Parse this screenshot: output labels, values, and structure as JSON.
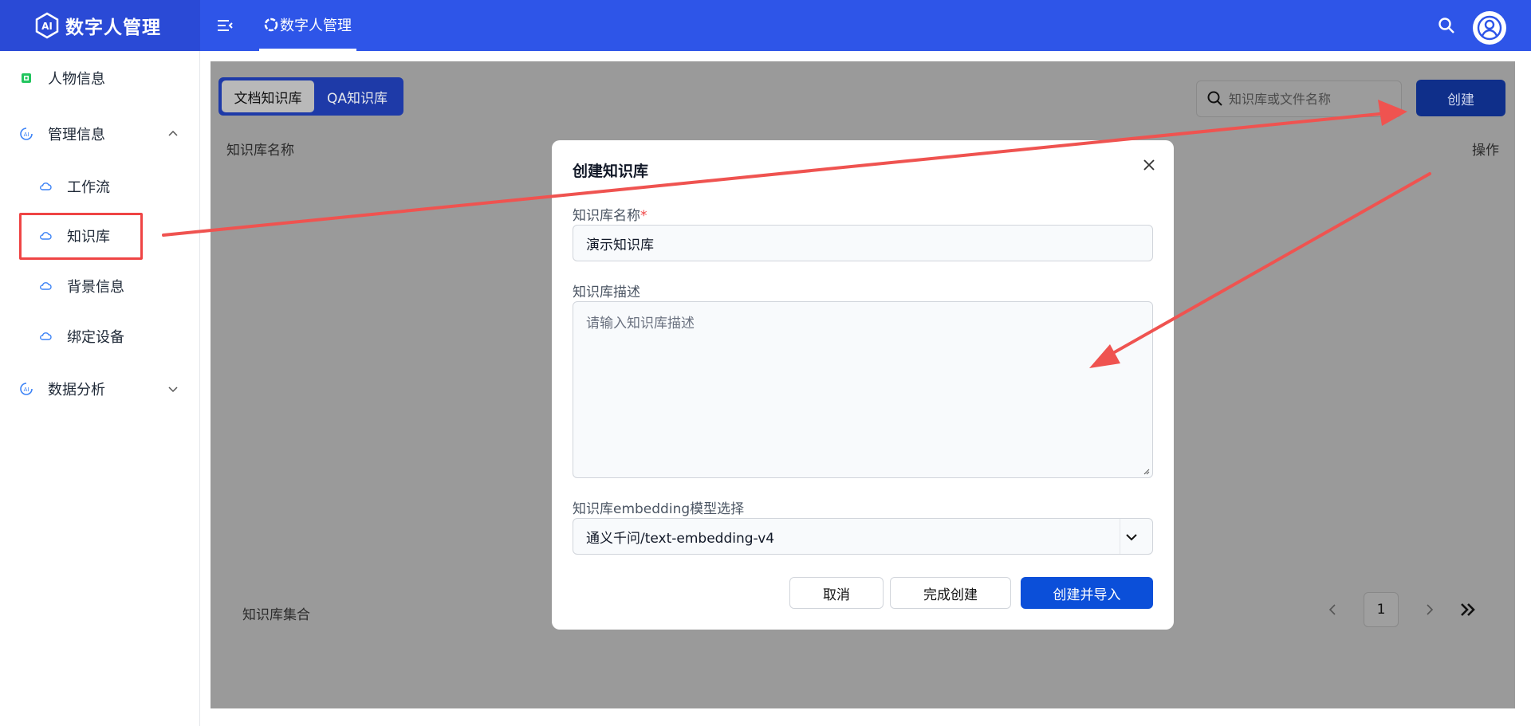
{
  "header": {
    "brand_title": "数字人管理",
    "active_tab": "数字人管理"
  },
  "sidebar": {
    "items": [
      {
        "label": "人物信息"
      },
      {
        "label": "管理信息"
      },
      {
        "label": "工作流"
      },
      {
        "label": "知识库"
      },
      {
        "label": "背景信息"
      },
      {
        "label": "绑定设备"
      },
      {
        "label": "数据分析"
      }
    ]
  },
  "main": {
    "tabs": [
      {
        "label": "文档知识库",
        "active": true
      },
      {
        "label": "QA知识库",
        "active": false
      }
    ],
    "search_placeholder": "知识库或文件名称",
    "create_label": "创建",
    "col_name": "知识库名称",
    "col_ops": "操作",
    "footer_label": "知识库集合",
    "pagination": {
      "current": "1"
    }
  },
  "modal": {
    "title": "创建知识库",
    "name_label": "知识库名称",
    "required_mark": "*",
    "name_value": "演示知识库",
    "desc_label": "知识库描述",
    "desc_placeholder": "请输入知识库描述",
    "model_label": "知识库embedding模型选择",
    "model_value": "通义千问/text-embedding-v4",
    "cancel_label": "取消",
    "finish_label": "完成创建",
    "create_import_label": "创建并导入"
  },
  "colors": {
    "header_blue": "#2e55e8",
    "primary_button": "#0b4fd9",
    "annotation_red": "#ef4444"
  }
}
